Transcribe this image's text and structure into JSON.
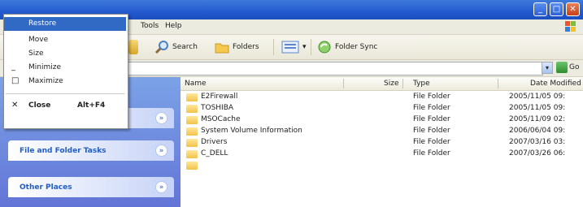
{
  "window_controls": {
    "minimize": "_",
    "maximize": "□",
    "close": "✕"
  },
  "menubar": {
    "items": [
      "Tools",
      "Help"
    ]
  },
  "toolbar": {
    "search": "Search",
    "folders": "Folders",
    "views": "▾",
    "folder_sync": "Folder Sync"
  },
  "addressbar": {
    "go": "Go"
  },
  "taskpane": {
    "panels": [
      {
        "label": "",
        "chevron": "»"
      },
      {
        "label": "File and Folder Tasks",
        "chevron": "»"
      },
      {
        "label": "Other Places",
        "chevron": "»"
      }
    ]
  },
  "filelist": {
    "columns": {
      "name": "Name",
      "size": "Size",
      "type": "Type",
      "date": "Date Modified"
    },
    "rows": [
      {
        "name": "E2Firewall",
        "type": "File Folder",
        "date": "2005/11/05 09:"
      },
      {
        "name": "TOSHIBA",
        "type": "File Folder",
        "date": "2005/11/05 09:"
      },
      {
        "name": "MSOCache",
        "type": "File Folder",
        "date": "2005/11/09 02:"
      },
      {
        "name": "System Volume Information",
        "type": "File Folder",
        "date": "2006/06/04 09:"
      },
      {
        "name": "Drivers",
        "type": "File Folder",
        "date": "2007/03/16 03:"
      },
      {
        "name": "C_DELL",
        "type": "File Folder",
        "date": "2007/03/26 06:"
      },
      {
        "name": "",
        "type": "",
        "date": ""
      }
    ]
  },
  "sysmenu": {
    "items": [
      {
        "label": "Restore",
        "icon": "",
        "state": "selected"
      },
      {
        "label": "Move",
        "icon": "",
        "state": "normal"
      },
      {
        "label": "Size",
        "icon": "",
        "state": "normal"
      },
      {
        "label": "Minimize",
        "icon": "_",
        "state": "normal"
      },
      {
        "label": "Maximize",
        "icon": "□",
        "state": "normal"
      },
      {
        "label": "Close",
        "icon": "✕",
        "shortcut": "Alt+F4",
        "state": "bold"
      }
    ]
  },
  "colors": {
    "titlebar": "#245ad0",
    "menu_highlight": "#316ac5",
    "taskpane": "#6375d6"
  }
}
